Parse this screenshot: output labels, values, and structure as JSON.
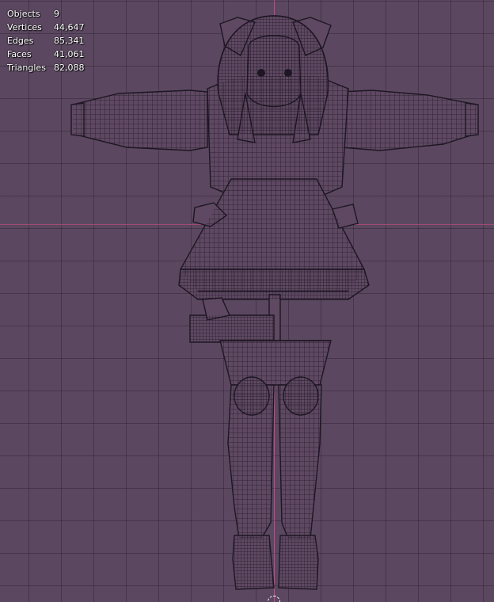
{
  "stats": [
    {
      "label": "Objects",
      "value": "9"
    },
    {
      "label": "Vertices",
      "value": "44,647"
    },
    {
      "label": "Edges",
      "value": "85,341"
    },
    {
      "label": "Faces",
      "value": "41,061"
    },
    {
      "label": "Triangles",
      "value": "82,088"
    }
  ],
  "colors": {
    "background": "#5b4860",
    "mesh_fill": "#5e4862",
    "wire": "#1e1622",
    "axis_x": "#a04a72",
    "axis_z": "#c04a88"
  },
  "icons": [
    "3d-cursor-icon"
  ]
}
